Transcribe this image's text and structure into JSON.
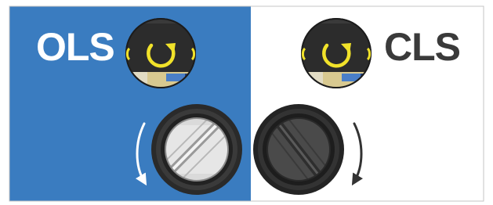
{
  "panels": {
    "left": {
      "label": "OLS",
      "label_color": "#ffffff",
      "background": "#3a7cc0",
      "icon": "refresh-icon",
      "knob_state": "light"
    },
    "right": {
      "label": "CLS",
      "label_color": "#3a3a3a",
      "background": "#ffffff",
      "icon": "refresh-icon",
      "knob_state": "dark"
    }
  },
  "colors": {
    "refresh_arrow": "#f1e22a",
    "icon_disc": "#2c2c2c",
    "knob_light": "#dadada",
    "knob_dark": "#4a4a4a",
    "rotation_arrow": "#333333"
  }
}
